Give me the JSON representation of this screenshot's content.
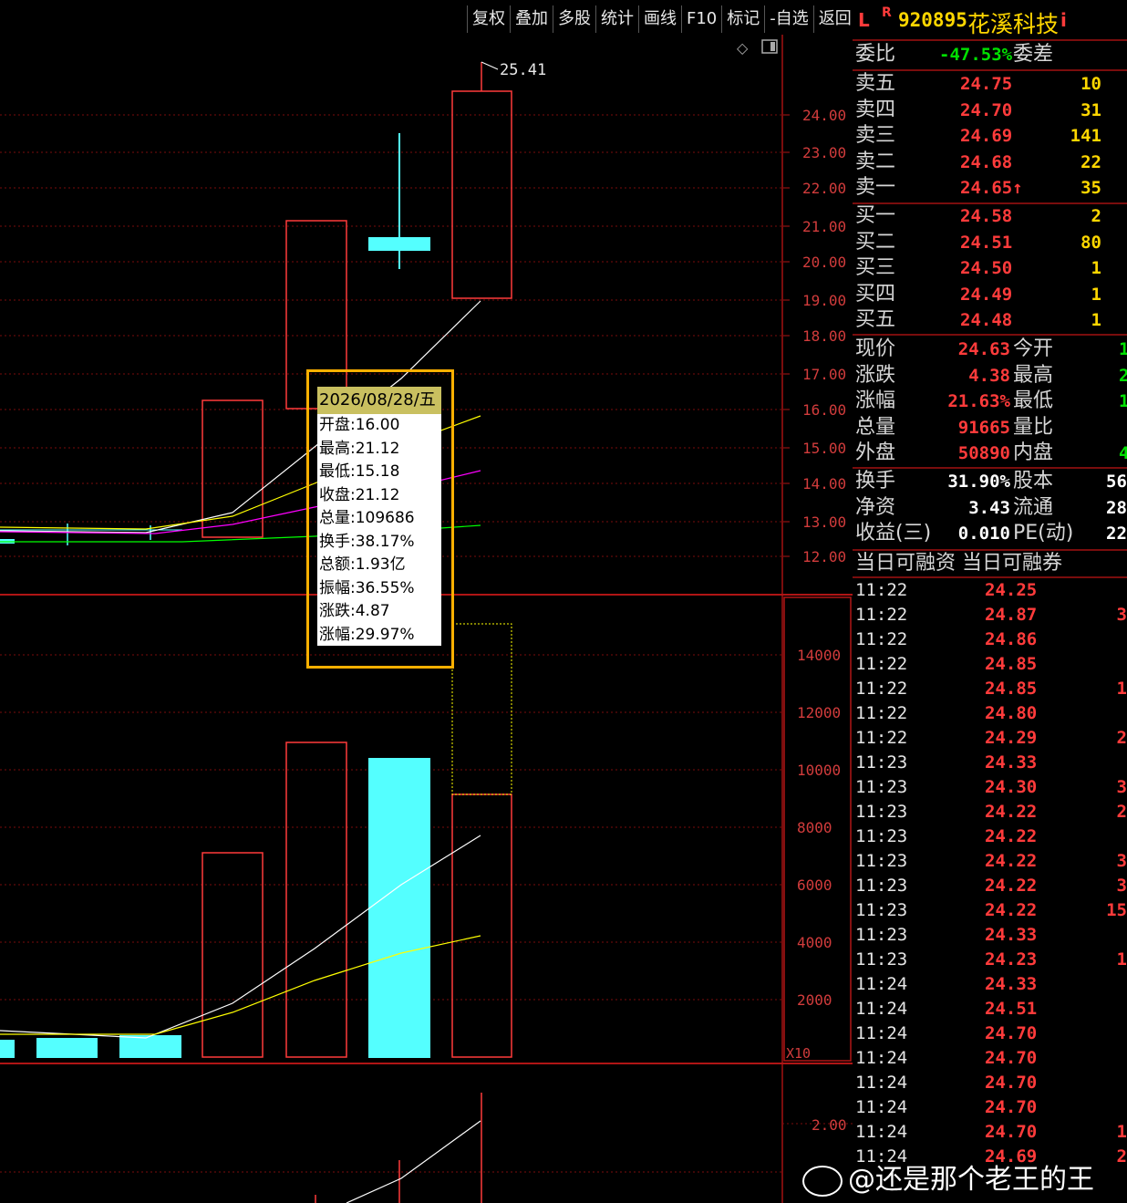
{
  "toolbar": [
    "复权",
    "叠加",
    "多股",
    "统计",
    "画线",
    "F10",
    "标记",
    "-自选",
    "返回"
  ],
  "stock": {
    "prefix": "L",
    "flag": "R",
    "code": "920895",
    "name": "花溪科技",
    "info": "i"
  },
  "weibi": {
    "label": "委比",
    "value": "-47.53%",
    "label2": "委差"
  },
  "sells": [
    {
      "label": "卖五",
      "price": "24.75",
      "vol": "10"
    },
    {
      "label": "卖四",
      "price": "24.70",
      "vol": "31"
    },
    {
      "label": "卖三",
      "price": "24.69",
      "vol": "141"
    },
    {
      "label": "卖二",
      "price": "24.68",
      "vol": "22"
    },
    {
      "label": "卖一",
      "price": "24.65↑",
      "vol": "35"
    }
  ],
  "buys": [
    {
      "label": "买一",
      "price": "24.58",
      "vol": "2"
    },
    {
      "label": "买二",
      "price": "24.51",
      "vol": "80"
    },
    {
      "label": "买三",
      "price": "24.50",
      "vol": "1"
    },
    {
      "label": "买四",
      "price": "24.49",
      "vol": "1"
    },
    {
      "label": "买五",
      "price": "24.48",
      "vol": "1"
    }
  ],
  "quote": [
    {
      "l1": "现价",
      "v1": "24.63",
      "l2": "今开",
      "v2": "1"
    },
    {
      "l1": "涨跌",
      "v1": "4.38",
      "l2": "最高",
      "v2": "2"
    },
    {
      "l1": "涨幅",
      "v1": "21.63%",
      "l2": "最低",
      "v2": "1"
    },
    {
      "l1": "总量",
      "v1": "91665",
      "l2": "量比",
      "v2": ""
    },
    {
      "l1": "外盘",
      "v1": "50890",
      "l2": "内盘",
      "v2": "4"
    }
  ],
  "fund": [
    {
      "l1": "换手",
      "v1": "31.90%",
      "l2": "股本",
      "v2": "56"
    },
    {
      "l1": "净资",
      "v1": "3.43",
      "l2": "流通",
      "v2": "28"
    },
    {
      "l1": "收益(三)",
      "v1": "0.010",
      "l2": "PE(动)",
      "v2": "22"
    }
  ],
  "margin_header": "当日可融资 当日可融券",
  "ticks": [
    {
      "t": "11:22",
      "p": "24.25",
      "v": ""
    },
    {
      "t": "11:22",
      "p": "24.87",
      "v": "3"
    },
    {
      "t": "11:22",
      "p": "24.86",
      "v": ""
    },
    {
      "t": "11:22",
      "p": "24.85",
      "v": ""
    },
    {
      "t": "11:22",
      "p": "24.85",
      "v": "1"
    },
    {
      "t": "11:22",
      "p": "24.80",
      "v": ""
    },
    {
      "t": "11:22",
      "p": "24.29",
      "v": "2"
    },
    {
      "t": "11:23",
      "p": "24.33",
      "v": ""
    },
    {
      "t": "11:23",
      "p": "24.30",
      "v": "3"
    },
    {
      "t": "11:23",
      "p": "24.22",
      "v": "2"
    },
    {
      "t": "11:23",
      "p": "24.22",
      "v": ""
    },
    {
      "t": "11:23",
      "p": "24.22",
      "v": "3"
    },
    {
      "t": "11:23",
      "p": "24.22",
      "v": "3"
    },
    {
      "t": "11:23",
      "p": "24.22",
      "v": "15"
    },
    {
      "t": "11:23",
      "p": "24.33",
      "v": ""
    },
    {
      "t": "11:23",
      "p": "24.23",
      "v": "1"
    },
    {
      "t": "11:24",
      "p": "24.33",
      "v": ""
    },
    {
      "t": "11:24",
      "p": "24.51",
      "v": ""
    },
    {
      "t": "11:24",
      "p": "24.70",
      "v": ""
    },
    {
      "t": "11:24",
      "p": "24.70",
      "v": ""
    },
    {
      "t": "11:24",
      "p": "24.70",
      "v": ""
    },
    {
      "t": "11:24",
      "p": "24.70",
      "v": ""
    },
    {
      "t": "11:24",
      "p": "24.70",
      "v": "1"
    },
    {
      "t": "11:24",
      "p": "24.69",
      "v": "2"
    }
  ],
  "tooltip": {
    "date": "2026/08/28/五",
    "lines": [
      "开盘:16.00",
      "最高:21.12",
      "最低:15.18",
      "收盘:21.12",
      "总量:109686",
      "换手:38.17%",
      "总额:1.93亿",
      "振幅:36.55%",
      "涨跌:4.87",
      "涨幅:29.97%"
    ]
  },
  "price_axis": [
    "24.00",
    "23.00",
    "22.00",
    "21.00",
    "20.00",
    "19.00",
    "18.00",
    "17.00",
    "16.00",
    "15.00",
    "14.00",
    "13.00",
    "12.00"
  ],
  "vol_axis": [
    "14000",
    "12000",
    "10000",
    "8000",
    "6000",
    "4000",
    "2000"
  ],
  "vol_unit": "X10",
  "ind_axis": [
    "2.00"
  ],
  "high_mark": "25.41",
  "watermark": "@还是那个老王的王",
  "colors": {
    "up": "#ff3b3b",
    "down": "#54ffff",
    "ma5": "#ffffff",
    "ma10": "#ffff00",
    "ma20": "#ff00ff",
    "ma60": "#00ff00",
    "grid": "#7a0d0d"
  },
  "chart_data": {
    "type": "candlestick",
    "candles": [
      {
        "open": 16.0,
        "high": 21.12,
        "low": 15.18,
        "close": 21.12,
        "volume": 109686,
        "up": true
      },
      {
        "open": 20.6,
        "high": 23.5,
        "low": 19.8,
        "close": 20.25,
        "up": false
      },
      {
        "open": 19.0,
        "high": 25.41,
        "low": 19.0,
        "close": 24.6,
        "up": true
      }
    ],
    "y_range": [
      11.6,
      25.8
    ],
    "volume_range": [
      0,
      15000
    ]
  }
}
